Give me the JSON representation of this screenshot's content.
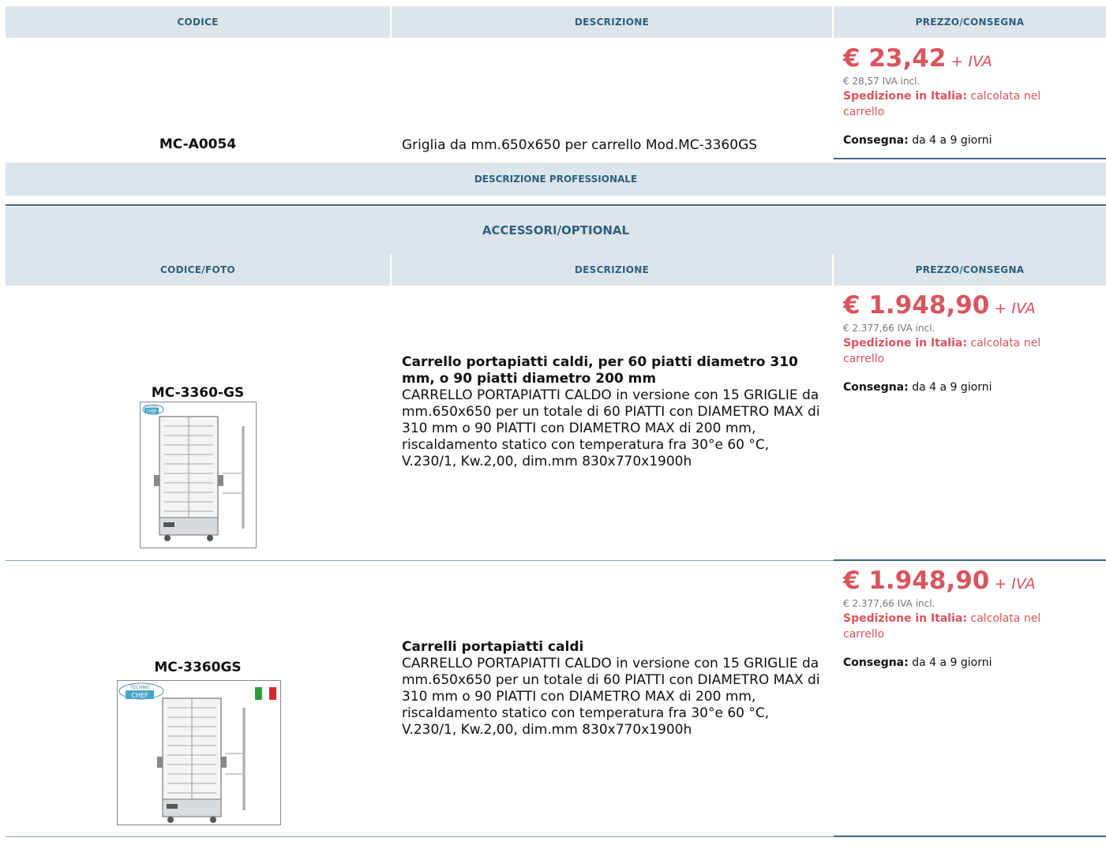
{
  "product_table": {
    "headers": {
      "code": "CODICE",
      "description": "DESCRIZIONE",
      "price": "PREZZO/CONSEGNA"
    },
    "row": {
      "code": "MC-A0054",
      "description": "Griglia da mm.650x650 per carrello Mod.MC-3360GS",
      "price": "€ 23,42",
      "price_suffix": "+ IVA",
      "vat_incl": "€ 28,57 IVA incl.",
      "shipping_label": "Spedizione in Italia:",
      "shipping_value": "calcolata nel carrello",
      "delivery_label": "Consegna:",
      "delivery_value": "da 4 a 9 giorni"
    },
    "professional_description": "DESCRIZIONE PROFESSIONALE"
  },
  "accessories": {
    "title": "ACCESSORI/OPTIONAL",
    "headers": {
      "code": "CODICE/FOTO",
      "description": "DESCRIZIONE",
      "price": "PREZZO/CONSEGNA"
    },
    "items": [
      {
        "code": "MC-3360-GS",
        "title": "Carrello portapiatti caldi, per 60 piatti diametro 310 mm, o 90 piatti diametro 200 mm",
        "body": "CARRELLO PORTAPIATTI CALDO in versione con 15 GRIGLIE da mm.650x650 per un totale di 60 PIATTI con DIAMETRO MAX di 310 mm o 90 PIATTI con DIAMETRO MAX di 200 mm, riscaldamento statico con temperatura fra 30°e 60 °C, V.230/1, Kw.2,00, dim.mm 830x770x1900h",
        "price": "€ 1.948,90",
        "price_suffix": "+ IVA",
        "vat_incl": "€ 2.377,66 IVA incl.",
        "shipping_label": "Spedizione in Italia:",
        "shipping_value": "calcolata nel carrello",
        "delivery_label": "Consegna:",
        "delivery_value": "da 4 a 9 giorni",
        "logo_text_top": "TECHNO",
        "logo_text_bottom": "CHEF"
      },
      {
        "code": "MC-3360GS",
        "title": "Carrelli portapiatti caldi",
        "body": "CARRELLO PORTAPIATTI CALDO in versione con 15 GRIGLIE da mm.650x650 per un totale di 60 PIATTI con DIAMETRO MAX di 310 mm o 90 PIATTI con DIAMETRO MAX di 200 mm, riscaldamento statico con temperatura fra 30°e 60 °C, V.230/1, Kw.2,00, dim.mm 830x770x1900h",
        "price": "€ 1.948,90",
        "price_suffix": "+ IVA",
        "vat_incl": "€ 2.377,66 IVA incl.",
        "shipping_label": "Spedizione in Italia:",
        "shipping_value": "calcolata nel carrello",
        "delivery_label": "Consegna:",
        "delivery_value": "da 4 a 9 giorni",
        "logo_text_top": "TECHNO",
        "logo_text_bottom": "CHEF"
      }
    ]
  },
  "colors": {
    "accent": "#d9545e",
    "header_bg": "#dde5ec",
    "header_text": "#2e5f7f",
    "rule": "#3d6785"
  },
  "icons": [
    "italian-flag-icon",
    "techno-chef-logo-icon"
  ]
}
